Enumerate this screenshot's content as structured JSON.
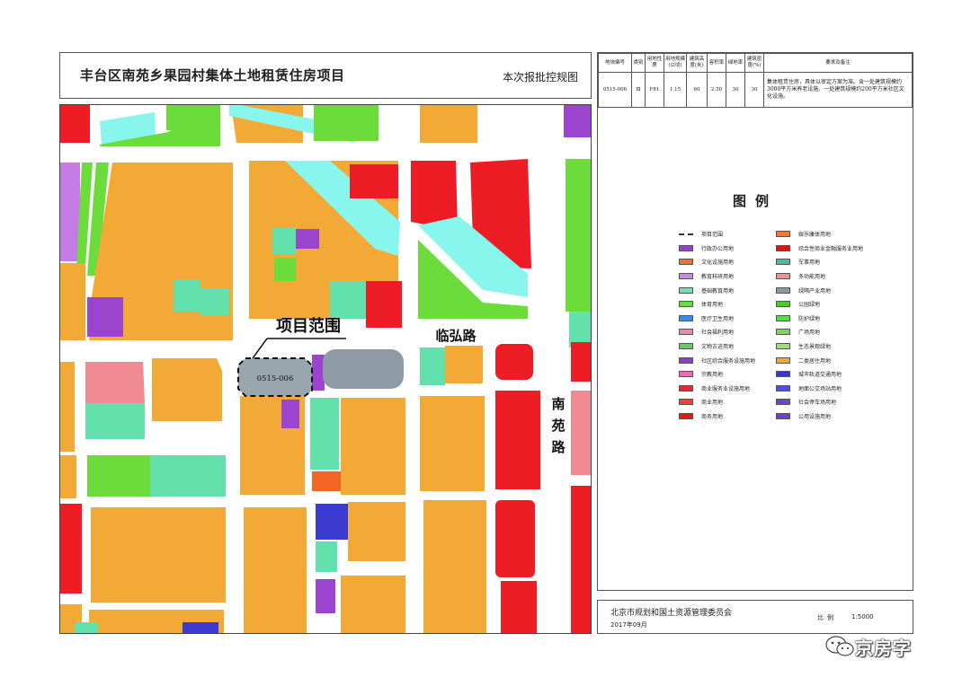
{
  "title": {
    "main": "丰台区南苑乡果园村集体土地租赁住房项目",
    "sub": "本次报批控规图"
  },
  "map": {
    "project_label": "项目范围",
    "parcel_code": "0515-006",
    "road_linhong": "临弘路",
    "road_nanyuan": "南苑路"
  },
  "info_table": {
    "headers": [
      "地块编号",
      "类别",
      "用地性质",
      "用地规模(公顷)",
      "建筑高度(米)",
      "容积率",
      "绿地率",
      "建筑密度(%)",
      "要求及备注"
    ],
    "row": [
      "0515-006",
      "Ⅲ",
      "F81",
      "1.15",
      "60",
      "2.50",
      "30",
      "30",
      "集体租赁住房，具体以审定方案为准。含一处建筑规模约3000平方米养老设施、一处建筑规模约200平方米社区文化设施。"
    ]
  },
  "legend": {
    "title": "图例",
    "left": [
      {
        "label": "项目范围",
        "color": "dashed"
      },
      {
        "label": "行政办公用地",
        "color": "#9b3fc6"
      },
      {
        "label": "文化设施用地",
        "color": "#f07030"
      },
      {
        "label": "教育科研用地",
        "color": "#c58ae6"
      },
      {
        "label": "基础教育用地",
        "color": "#6fe0b8"
      },
      {
        "label": "体育用地",
        "color": "#66dd44"
      },
      {
        "label": "医疗卫生用地",
        "color": "#3f8ae8"
      },
      {
        "label": "社会福利用地",
        "color": "#ee8aa8"
      },
      {
        "label": "文物古迹用地",
        "color": "#6cc85a"
      },
      {
        "label": "社区综合服务设施用地",
        "color": "#8a3fd0"
      },
      {
        "label": "宗教用地",
        "color": "#e870b0"
      },
      {
        "label": "商业服务业设施用地",
        "color": "#e82828"
      },
      {
        "label": "商业用地",
        "color": "#f04040"
      },
      {
        "label": "商务用地",
        "color": "#e81818"
      }
    ],
    "right": [
      {
        "label": "娱乐康体用地",
        "color": "#f07840"
      },
      {
        "label": "综合性商业金融服务业用地",
        "color": "#d81818"
      },
      {
        "label": "军事用地",
        "color": "#4fb8a8"
      },
      {
        "label": "多功能用地",
        "color": "#f09090"
      },
      {
        "label": "绿隔产业用地",
        "color": "#8a9aa4"
      },
      {
        "label": "公园绿地",
        "color": "#4ccc2c"
      },
      {
        "label": "防护绿地",
        "color": "#5cd84c"
      },
      {
        "label": "广场用地",
        "color": "#7cd850"
      },
      {
        "label": "生态景观绿地",
        "color": "#9ce070"
      },
      {
        "label": "二类居住用地",
        "color": "#f0a830"
      },
      {
        "label": "城市轨道交通用地",
        "color": "#3838c8"
      },
      {
        "label": "地面公交场站用地",
        "color": "#5050d0"
      },
      {
        "label": "社会停车场用地",
        "color": "#6848c8"
      },
      {
        "label": "公用设施用地",
        "color": "#7040d0"
      }
    ]
  },
  "footer": {
    "org": "北京市规划和国土资源管理委员会",
    "date": "2017年09月",
    "scale_label": "比例",
    "scale_value": "1:5000"
  },
  "watermark": {
    "text": "京房字",
    "icon": "wechat-icon"
  },
  "colors": {
    "residential": "#f3a935",
    "green": "#6cdc3c",
    "water": "#88f6ec",
    "red": "#ee1c24",
    "purple": "#9b44d0",
    "gray": "#8f9ba4",
    "mint": "#63e1ad",
    "pink": "#f08a93",
    "blue": "#3b3ad1",
    "magenta": "#c47be4",
    "orange": "#f26522"
  }
}
